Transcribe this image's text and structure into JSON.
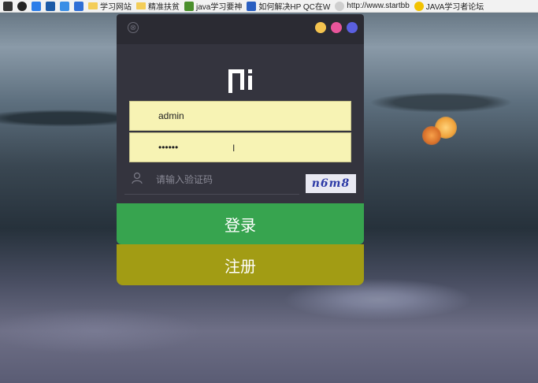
{
  "bookmarks": [
    {
      "label": "",
      "icon": "app-icon",
      "color": "#333333"
    },
    {
      "label": "",
      "icon": "github-icon",
      "color": "#222222"
    },
    {
      "label": "",
      "icon": "app-icon",
      "color": "#2b7de9"
    },
    {
      "label": "",
      "icon": "app-icon",
      "color": "#1c5aa6"
    },
    {
      "label": "",
      "icon": "app-icon",
      "color": "#3a8ee6"
    },
    {
      "label": "",
      "icon": "app-icon",
      "color": "#2f6fd6"
    },
    {
      "label": "学习网站",
      "icon": "folder-icon"
    },
    {
      "label": "精准扶贫",
      "icon": "folder-icon"
    },
    {
      "label": "java学习要神",
      "icon": "folder-icon",
      "color": "#4a8f2c"
    },
    {
      "label": "如何解决HP QC在W",
      "icon": "paw-icon",
      "color": "#2a5fc1"
    },
    {
      "label": "http://www.startbb",
      "icon": "globe-icon"
    },
    {
      "label": "JAVA学习者论坛",
      "icon": "bulb-icon",
      "color": "#f2c200"
    }
  ],
  "window": {
    "close_symbol": "⊗",
    "dots": [
      "#f5c44f",
      "#e8559b",
      "#5a5fe0"
    ],
    "logo_icon": "brand-logo-icon"
  },
  "form": {
    "username_value": "admin",
    "password_value": "••••••",
    "captcha_placeholder": "请输入验证码",
    "captcha_text": "n6m8"
  },
  "buttons": {
    "login_label": "登录",
    "register_label": "注册"
  },
  "colors": {
    "login_button": "#37a44f",
    "register_button": "#a29c14",
    "field_background": "#f7f3b4",
    "panel_background": "#34343e"
  }
}
